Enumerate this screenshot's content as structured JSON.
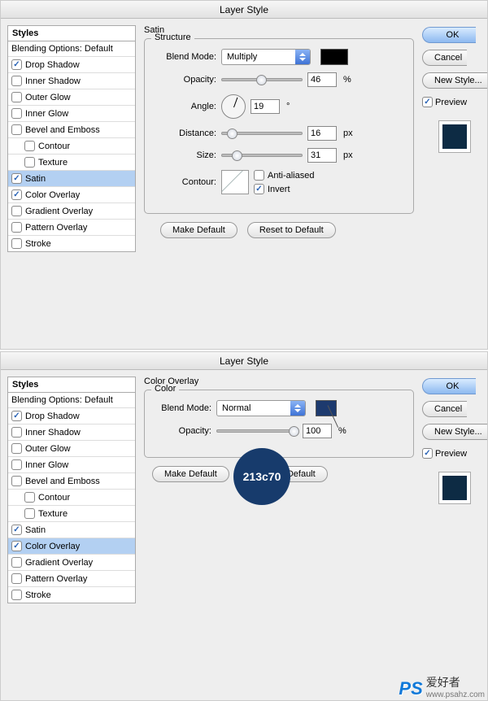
{
  "dialog_title": "Layer Style",
  "styles_header": "Styles",
  "blending_label": "Blending Options: Default",
  "style_items": [
    {
      "label": "Drop Shadow",
      "checked": true
    },
    {
      "label": "Inner Shadow",
      "checked": false
    },
    {
      "label": "Outer Glow",
      "checked": false
    },
    {
      "label": "Inner Glow",
      "checked": false
    },
    {
      "label": "Bevel and Emboss",
      "checked": false
    },
    {
      "label": "Contour",
      "checked": false,
      "indent": true
    },
    {
      "label": "Texture",
      "checked": false,
      "indent": true
    },
    {
      "label": "Satin",
      "checked": true
    },
    {
      "label": "Color Overlay",
      "checked": true
    },
    {
      "label": "Gradient Overlay",
      "checked": false
    },
    {
      "label": "Pattern Overlay",
      "checked": false
    },
    {
      "label": "Stroke",
      "checked": false
    }
  ],
  "satin": {
    "section": "Satin",
    "structure": "Structure",
    "blend_mode_label": "Blend Mode:",
    "blend_mode_value": "Multiply",
    "swatch": "#000000",
    "opacity_label": "Opacity:",
    "opacity_value": "46",
    "angle_label": "Angle:",
    "angle_value": "19",
    "angle_unit": "°",
    "distance_label": "Distance:",
    "distance_value": "16",
    "size_label": "Size:",
    "size_value": "31",
    "px": "px",
    "percent": "%",
    "contour_label": "Contour:",
    "anti_label": "Anti-aliased",
    "invert_label": "Invert",
    "make_default": "Make Default",
    "reset_default": "Reset to Default"
  },
  "coloroverlay": {
    "section": "Color Overlay",
    "color_group": "Color",
    "blend_mode_label": "Blend Mode:",
    "blend_mode_value": "Normal",
    "swatch": "#1d3a6e",
    "opacity_label": "Opacity:",
    "opacity_value": "100",
    "percent": "%",
    "make_default": "Make Default",
    "reset_default": "Reset to Default"
  },
  "buttons": {
    "ok": "OK",
    "cancel": "Cancel",
    "new_style": "New Style...",
    "preview": "Preview"
  },
  "callout": "213c70",
  "watermark": {
    "ps": "PS",
    "cn": "爱好者",
    "url": "www.psahz.com"
  }
}
